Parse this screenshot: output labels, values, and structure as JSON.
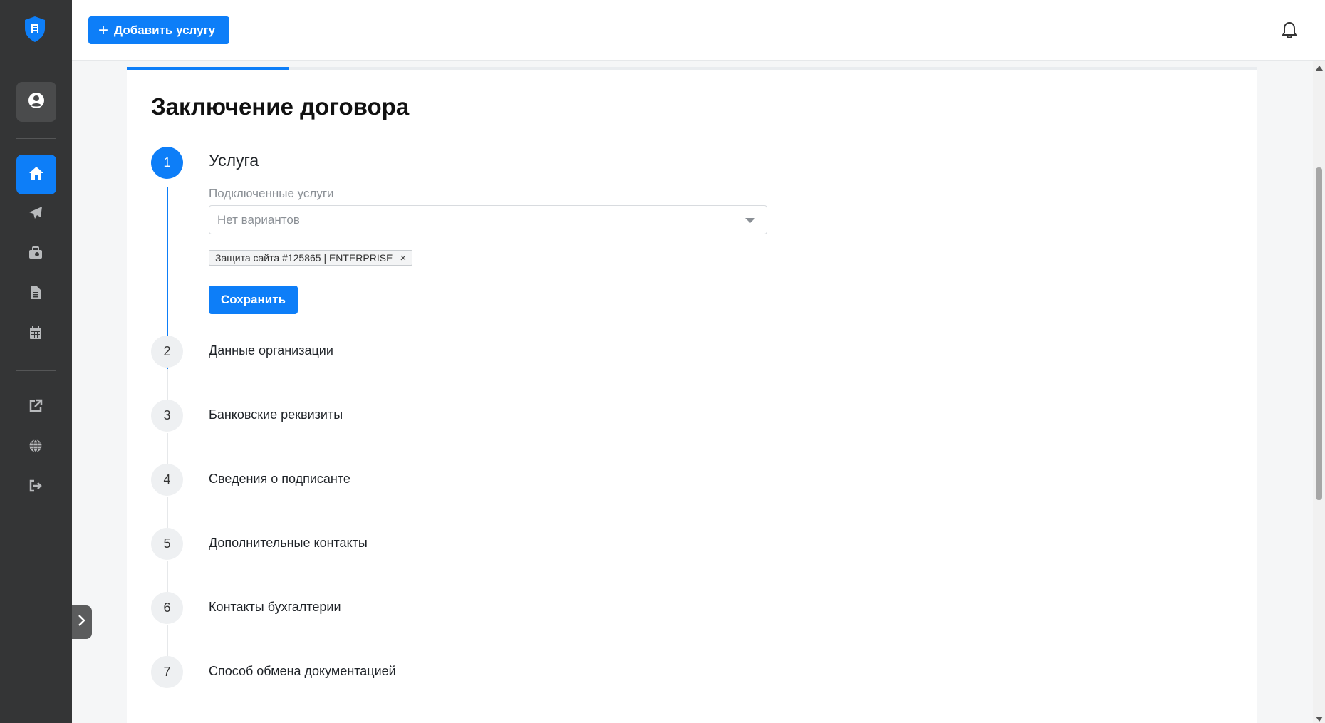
{
  "colors": {
    "sidebar_bg": "#343536",
    "accent": "#0d7ef8",
    "card_bg": "#ffffff",
    "page_bg": "#f5f6f7"
  },
  "header": {
    "add_service_label": "Добавить услугу",
    "add_icon": "plus-icon",
    "notifications_icon": "bell-icon"
  },
  "sidebar": {
    "logo": "shield-logo",
    "items": [
      {
        "name": "profile",
        "icon": "user-circle-icon",
        "active": false
      },
      {
        "name": "home",
        "icon": "home-icon",
        "active": true
      },
      {
        "name": "send",
        "icon": "paper-plane-icon",
        "active": false
      },
      {
        "name": "services",
        "icon": "briefcase-icon",
        "active": false
      },
      {
        "name": "documents",
        "icon": "document-icon",
        "active": false
      },
      {
        "name": "calendar",
        "icon": "calendar-icon",
        "active": false
      },
      {
        "name": "external-link",
        "icon": "external-link-icon",
        "active": false
      },
      {
        "name": "language",
        "icon": "globe-icon",
        "active": false
      },
      {
        "name": "logout",
        "icon": "logout-icon",
        "active": false
      }
    ],
    "collapse_icon": "chevron-right-icon"
  },
  "main": {
    "progress": 0.143,
    "title": "Заключение договора",
    "steps": [
      {
        "number": "1",
        "label": "Услуга",
        "active": true
      },
      {
        "number": "2",
        "label": "Данные организации",
        "active": false
      },
      {
        "number": "3",
        "label": "Банковские реквизиты",
        "active": false
      },
      {
        "number": "4",
        "label": "Сведения о подписанте",
        "active": false
      },
      {
        "number": "5",
        "label": "Дополнительные контакты",
        "active": false
      },
      {
        "number": "6",
        "label": "Контакты бухгалтерии",
        "active": false
      },
      {
        "number": "7",
        "label": "Способ обмена документацией",
        "active": false
      }
    ],
    "service_field": {
      "label": "Подключенные услуги",
      "placeholder": "Нет вариантов",
      "selected_chip": "Защита сайта #125865 | ENTERPRISE",
      "chip_remove": "×"
    },
    "save_label": "Сохранить"
  }
}
